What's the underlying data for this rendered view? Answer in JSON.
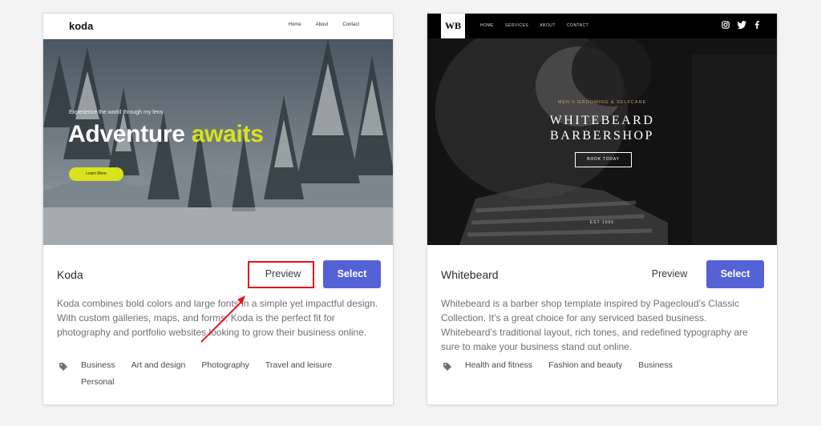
{
  "cards": [
    {
      "preview": {
        "logo": "koda",
        "nav": [
          "Home",
          "About",
          "Contact"
        ],
        "tagline": "Experience the world through my lens",
        "headline_a": "Adventure",
        "headline_b": "awaits",
        "button": "Learn More",
        "accent": "#d9e21b"
      },
      "name": "Koda",
      "preview_label": "Preview",
      "select_label": "Select",
      "description": "Koda combines bold colors and large fonts in a simple yet impactful design. With custom galleries, maps, and forms, Koda is the perfect fit for photography and portfolio websites looking to grow their business online.",
      "tags_row1": [
        "Business",
        "Art and design",
        "Photography",
        "Travel and leisure"
      ],
      "tags_row2": [
        "Personal"
      ]
    },
    {
      "preview": {
        "logo": "WB",
        "nav": [
          "HOME",
          "SERVICES",
          "ABOUT",
          "CONTACT"
        ],
        "social": [
          "instagram-icon",
          "twitter-icon",
          "facebook-icon"
        ],
        "subtitle": "MEN'S GROOMING & SELFCARE",
        "title_line1": "WHITEBEARD",
        "title_line2": "BARBERSHOP",
        "button": "BOOK TODAY",
        "est": "EST 1995",
        "accent": "#c9a063"
      },
      "name": "Whitebeard",
      "preview_label": "Preview",
      "select_label": "Select",
      "description": "Whitebeard is a barber shop template inspired by Pagecloud’s Classic Collection. It’s a great choice for any serviced based business. Whitebeard’s traditional layout, rich tones, and redefined typography are sure to make your business stand out online.",
      "tags_row1": [
        "Health and fitness",
        "Fashion and beauty",
        "Business"
      ]
    }
  ],
  "colors": {
    "select_button": "#5462d6",
    "annotation": "#e8141a"
  }
}
